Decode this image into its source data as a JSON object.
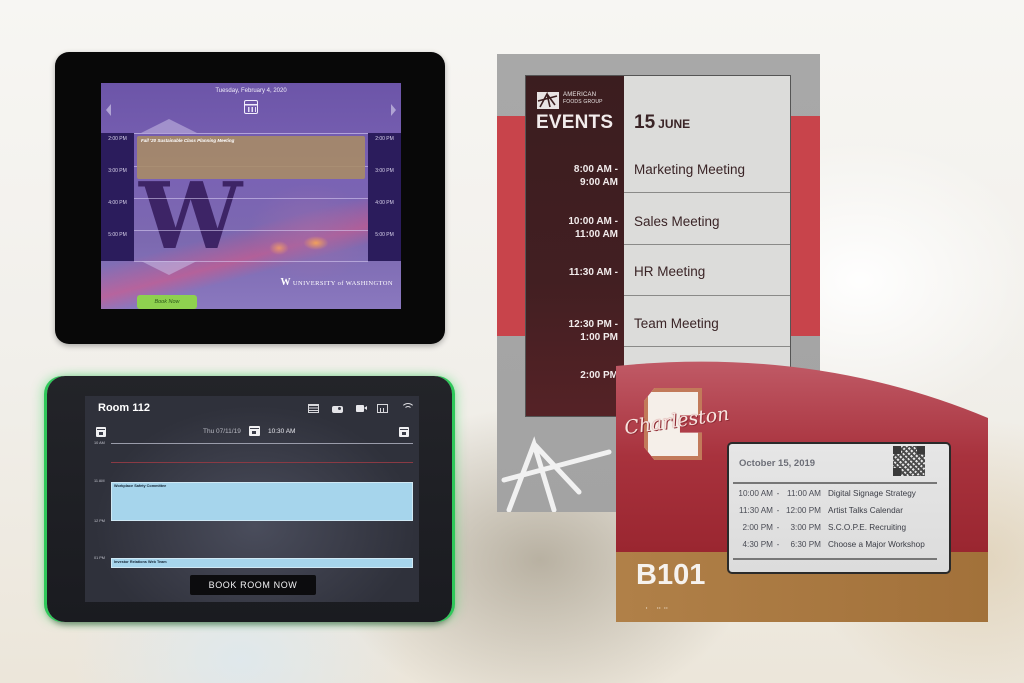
{
  "uw_tablet": {
    "date": "Tuesday, February 4, 2020",
    "icons": [
      "calendar-icon",
      "chevron-left-icon",
      "chevron-right-icon",
      "arrow-up-icon",
      "arrow-down-icon"
    ],
    "times_left": [
      "2:00 PM",
      "3:00 PM",
      "4:00 PM",
      "5:00 PM"
    ],
    "times_right": [
      "2:00 PM",
      "3:00 PM",
      "4:00 PM",
      "5:00 PM"
    ],
    "event_title": "Fall '20 Sustainable Class Planning Meeting",
    "logo_letter": "W",
    "brand_w": "W",
    "brand_text": "UNIVERSITY of WASHINGTON",
    "book_label": "Book Now",
    "colors": {
      "accent": "#8ed14f",
      "purple": "#2b1c5c",
      "event": "#a88c64"
    }
  },
  "room_tablet": {
    "room_name": "Room 112",
    "icons": [
      "phone-icon",
      "projector-icon",
      "video-camera-icon",
      "whiteboard-icon",
      "wifi-icon"
    ],
    "date": "Thu 07/11/19",
    "current_time": "10:30 AM",
    "hours": [
      "10 AM",
      "11 AM",
      "12 PM",
      "01 PM"
    ],
    "events": [
      {
        "title": "Workplace Safety Committee"
      },
      {
        "title": "Investor Relations Web Team"
      }
    ],
    "book_label": "BOOK ROOM NOW",
    "colors": {
      "led": "#2fc85a",
      "event": "#a6d5ec",
      "now_line": "#8a3a44"
    }
  },
  "afg_sign": {
    "logo_line1": "AMERICAN",
    "logo_line2": "FOODS GROUP",
    "header": "EVENTS",
    "day": "15",
    "month": "JUNE",
    "events": [
      {
        "time1": "8:00 AM -",
        "time2": "9:00 AM",
        "title": "Marketing Meeting"
      },
      {
        "time1": "10:00 AM -",
        "time2": "11:00 AM",
        "title": "Sales Meeting"
      },
      {
        "time1": "11:30 AM -",
        "time2": "",
        "title": "HR Meeting"
      },
      {
        "time1": "12:30 PM -",
        "time2": "1:00 PM",
        "title": "Team Meeting"
      },
      {
        "time1": "2:00 PM",
        "time2": "",
        "title": ""
      }
    ],
    "colors": {
      "maroon": "#3b1d1f",
      "red": "#c8444b",
      "gray": "#a8a8a8"
    }
  },
  "charleston_sign": {
    "script_text": "Charleston",
    "logo_letter": "C",
    "date": "October 15, 2019",
    "events": [
      {
        "start": "10:00 AM",
        "end": "11:00 AM",
        "title": "Digital Signage Strategy"
      },
      {
        "start": "11:30 AM",
        "end": "12:00 PM",
        "title": "Artist Talks Calendar"
      },
      {
        "start": "2:00 PM",
        "end": "3:00 PM",
        "title": "S.C.O.P.E. Recruiting"
      },
      {
        "start": "4:30 PM",
        "end": "6:30 PM",
        "title": "Choose a Major Workshop"
      }
    ],
    "dash": "-",
    "room": "B101",
    "braille": "⠂ ⠒⠒",
    "colors": {
      "red": "#a8303a",
      "gold": "#a8763e"
    }
  }
}
